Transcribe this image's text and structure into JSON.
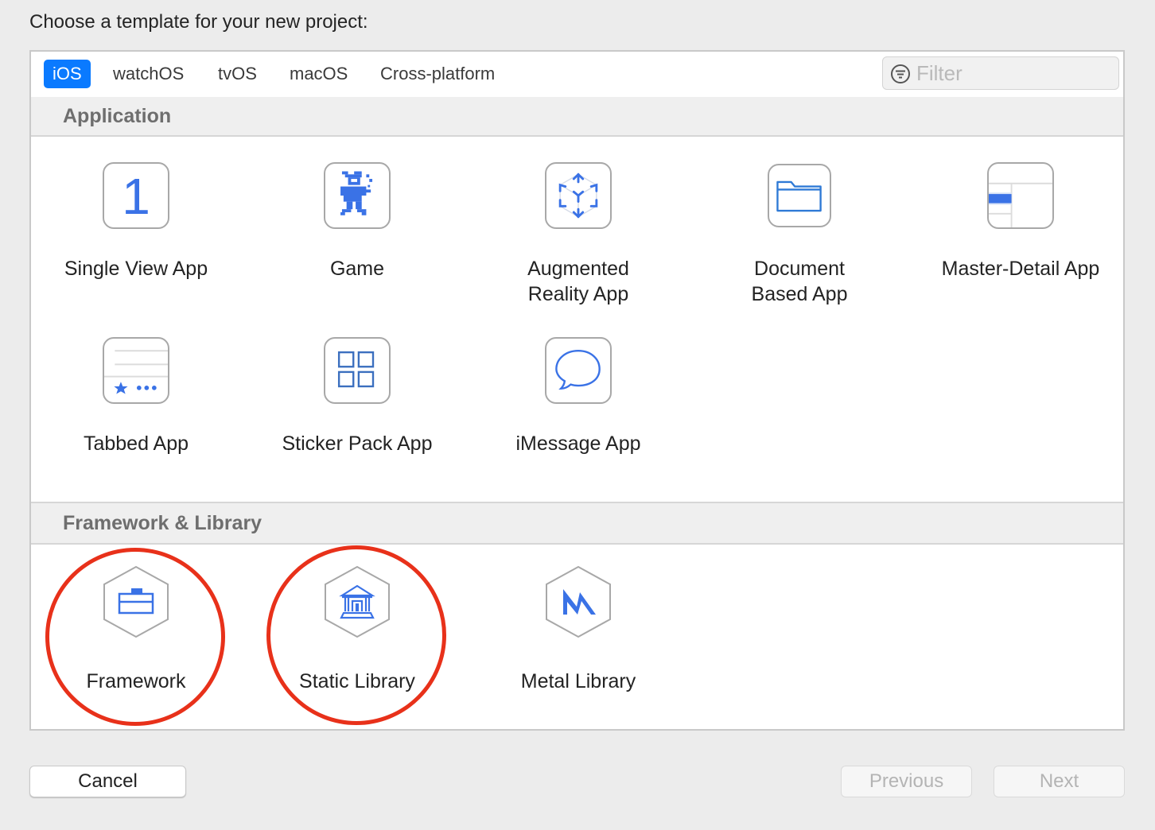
{
  "prompt": "Choose a template for your new project:",
  "tabs": [
    {
      "label": "iOS",
      "active": true
    },
    {
      "label": "watchOS",
      "active": false
    },
    {
      "label": "tvOS",
      "active": false
    },
    {
      "label": "macOS",
      "active": false
    },
    {
      "label": "Cross-platform",
      "active": false
    }
  ],
  "filter": {
    "placeholder": "Filter",
    "value": "",
    "icon": "filter-icon"
  },
  "sections": [
    {
      "title": "Application",
      "items": [
        {
          "label": "Single View App",
          "icon": "single-view-icon"
        },
        {
          "label": "Game",
          "icon": "game-sprite-icon"
        },
        {
          "label": "Augmented Reality App",
          "icon": "ar-cube-icon"
        },
        {
          "label": "Document Based App",
          "icon": "folder-icon"
        },
        {
          "label": "Master-Detail App",
          "icon": "master-detail-icon"
        },
        {
          "label": "Tabbed App",
          "icon": "tabbed-icon"
        },
        {
          "label": "Sticker Pack App",
          "icon": "sticker-grid-icon"
        },
        {
          "label": "iMessage App",
          "icon": "message-bubble-icon"
        }
      ]
    },
    {
      "title": "Framework & Library",
      "items": [
        {
          "label": "Framework",
          "icon": "toolbox-icon",
          "highlighted": true
        },
        {
          "label": "Static Library",
          "icon": "library-building-icon",
          "highlighted": true
        },
        {
          "label": "Metal Library",
          "icon": "metal-icon",
          "highlighted": false
        }
      ]
    }
  ],
  "single_view_glyph": "1",
  "buttons": {
    "cancel": "Cancel",
    "previous": "Previous",
    "next": "Next"
  },
  "colors": {
    "accent": "#0a7aff",
    "icon_blue": "#3a72e6",
    "annotation_red": "#e8311a"
  }
}
